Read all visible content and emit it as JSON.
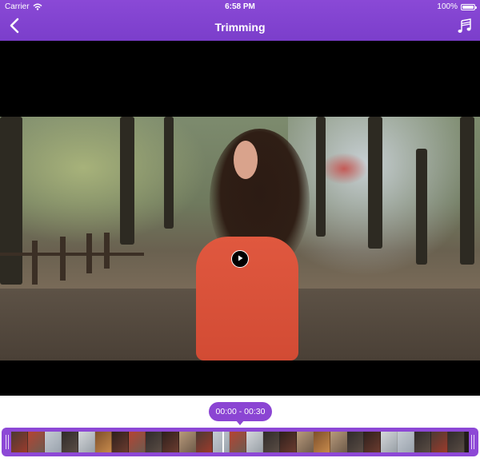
{
  "status_bar": {
    "carrier": "Carrier",
    "time": "6:58 PM",
    "battery": "100%"
  },
  "nav": {
    "title": "Trimming",
    "back_icon": "chevron-left-icon",
    "music_icon": "music-notes-icon"
  },
  "video": {
    "play_icon": "play-icon"
  },
  "trim": {
    "time_range": "00:00 - 00:30"
  },
  "colors": {
    "accent": "#7b3ecb",
    "timeline": "#8d48d6",
    "background": "#000000"
  }
}
